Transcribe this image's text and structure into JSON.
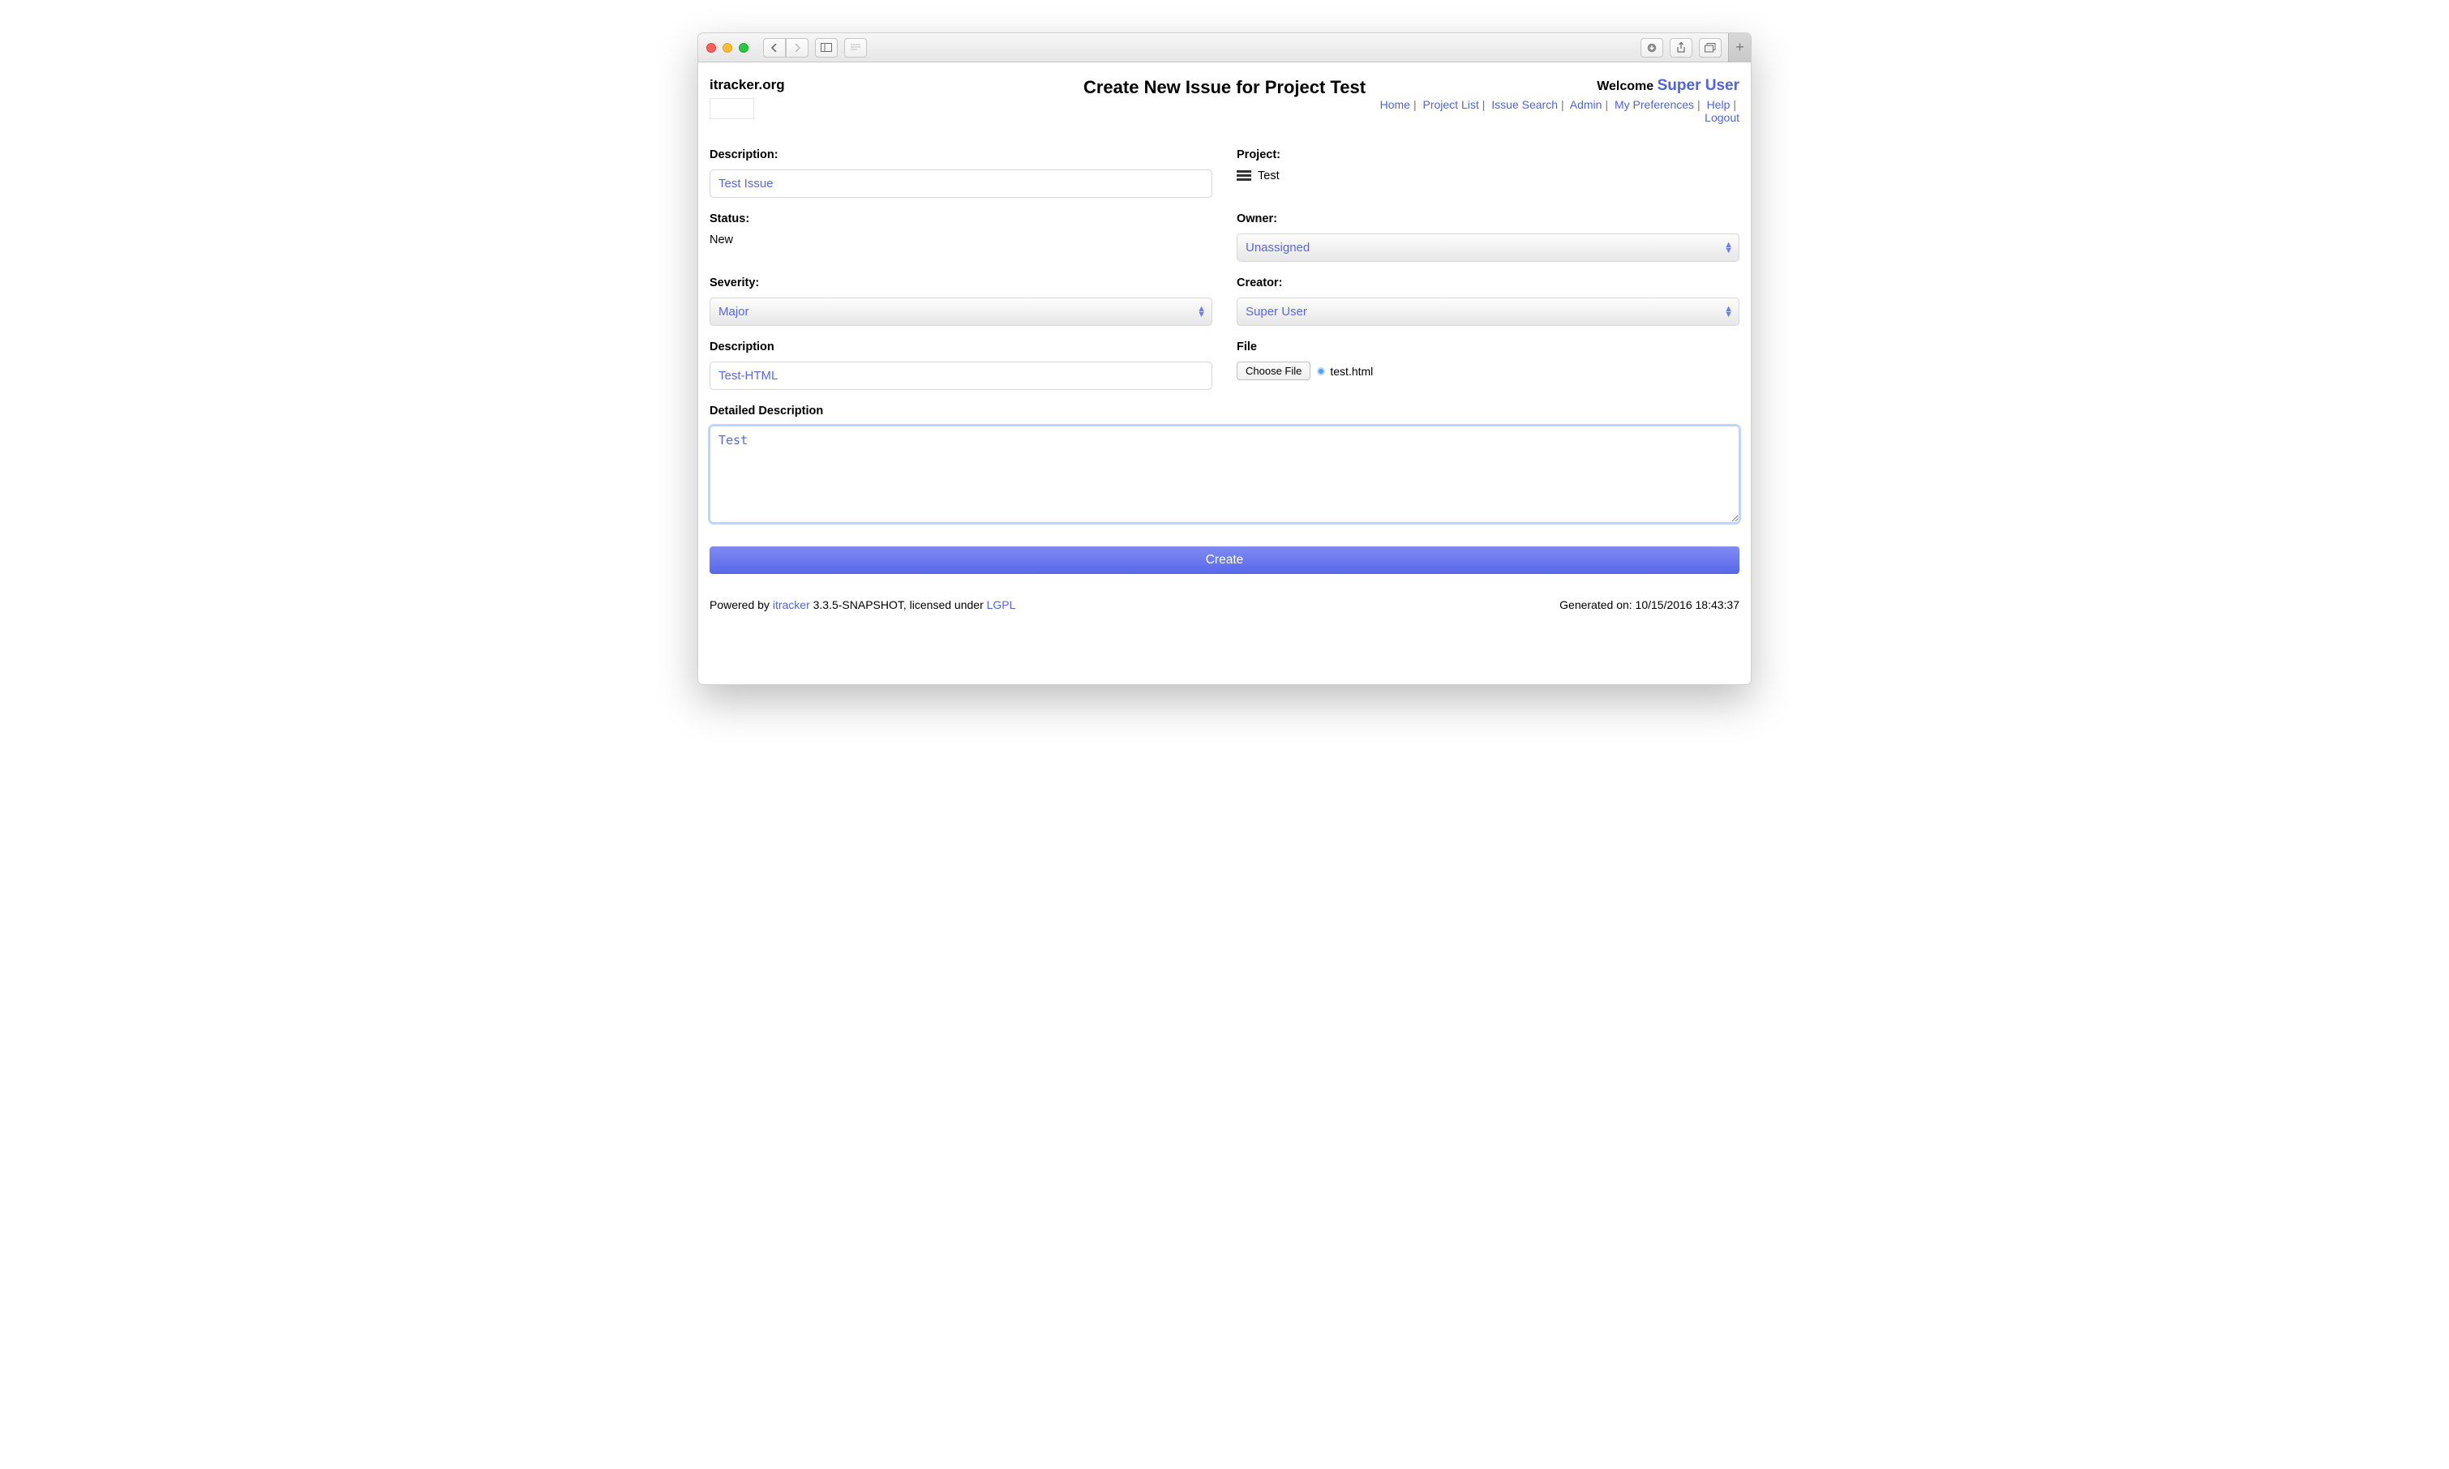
{
  "brand": "itracker.org",
  "pageTitle": "Create New Issue for Project Test",
  "welcomeLabel": "Welcome ",
  "welcomeUser": "Super User",
  "nav": {
    "home": "Home",
    "projectList": "Project List",
    "issueSearch": "Issue Search",
    "admin": "Admin",
    "myPreferences": "My Preferences",
    "help": "Help",
    "logout": "Logout"
  },
  "labels": {
    "description": "Description:",
    "project": "Project:",
    "status": "Status:",
    "owner": "Owner:",
    "severity": "Severity:",
    "creator": "Creator:",
    "description2": "Description",
    "file": "File",
    "detailed": "Detailed Description",
    "chooseFile": "Choose File"
  },
  "values": {
    "descriptionInput": "Test Issue",
    "projectName": "Test",
    "statusText": "New",
    "ownerSelected": "Unassigned",
    "severitySelected": "Major",
    "creatorSelected": "Super User",
    "description2Input": "Test-HTML",
    "fileName": "test.html",
    "detailedText": "Test",
    "submitLabel": "Create"
  },
  "footer": {
    "poweredByPrefix": "Powered by ",
    "poweredByLink": "itracker",
    "poweredBySuffix": " 3.3.5-SNAPSHOT, licensed under ",
    "licenseLink": "LGPL",
    "generated": "Generated on: 10/15/2016 18:43:37"
  }
}
